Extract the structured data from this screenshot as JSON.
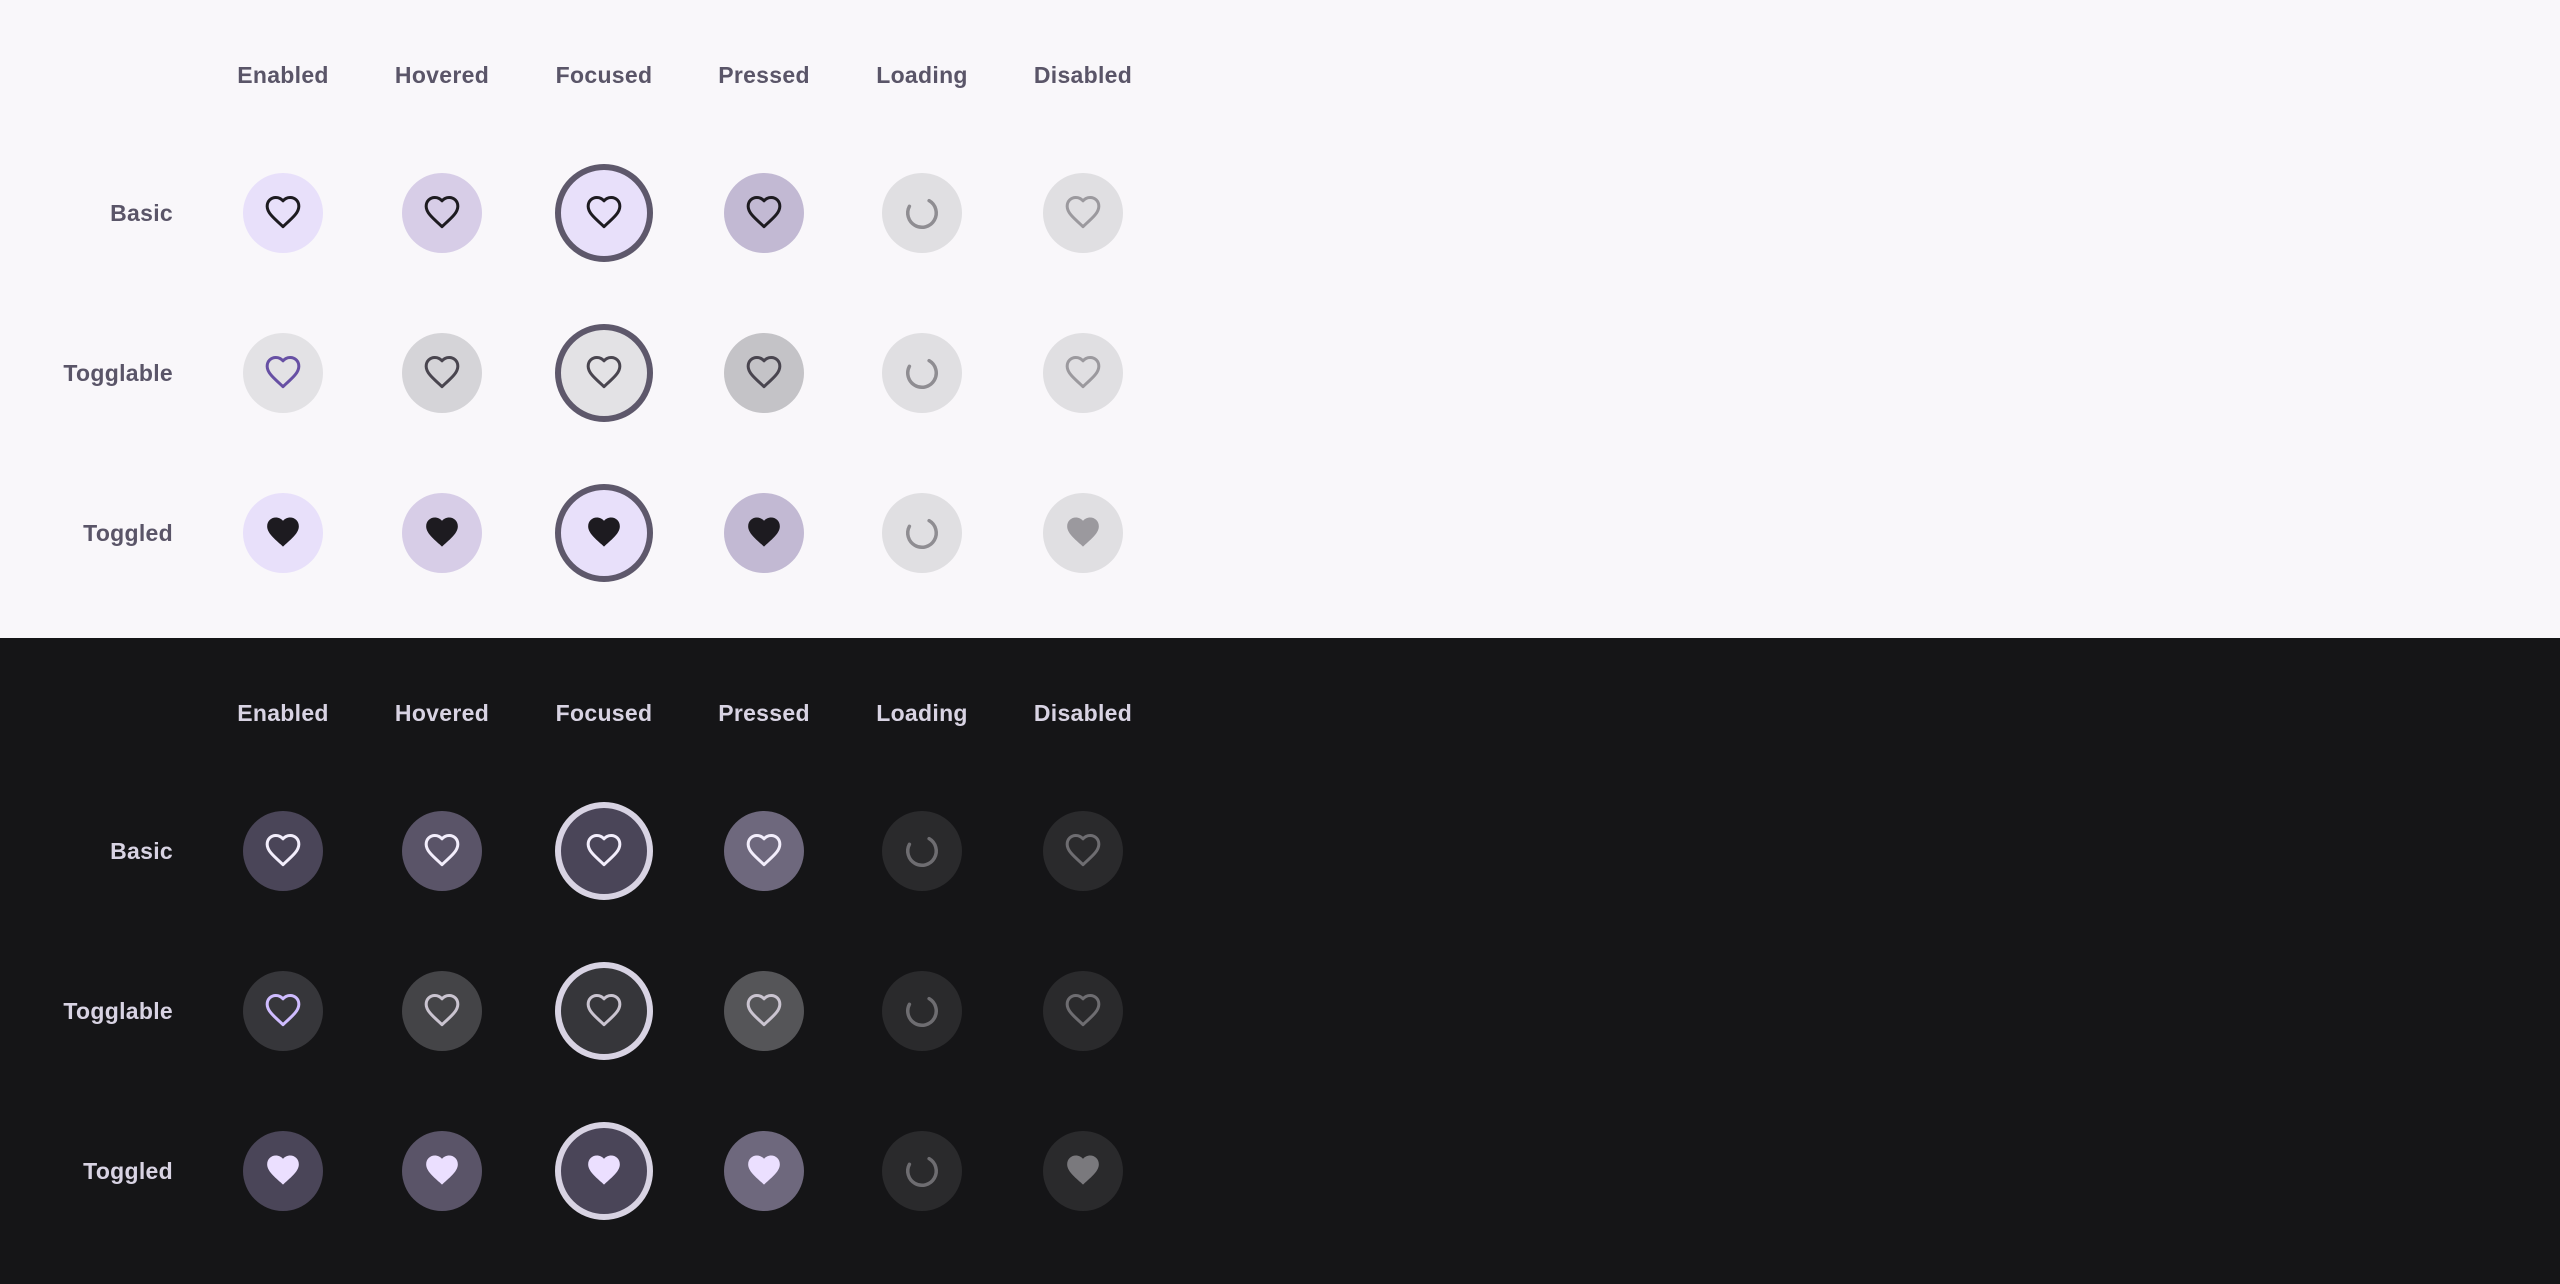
{
  "columns": [
    "Enabled",
    "Hovered",
    "Focused",
    "Pressed",
    "Loading",
    "Disabled"
  ],
  "rows": [
    "Basic",
    "Togglable",
    "Toggled"
  ],
  "states": [
    "enabled",
    "hovered",
    "focused",
    "pressed",
    "loading",
    "disabled"
  ],
  "icons": {
    "outline": "heart-outline-icon",
    "filled": "heart-filled-icon",
    "loading": "progress-spinner-icon"
  },
  "themes": {
    "light": {
      "name": "light",
      "background": "#f9f7fa",
      "text": "#5a5568",
      "focus_ring": "#5e586b",
      "rows": {
        "Basic": {
          "icon": "outline",
          "bg": [
            "#e8e0fa",
            "#d7cde7",
            "#e8e0fa",
            "#c2b9d3",
            "#e0dfe2",
            "#e0dfe2"
          ],
          "fg": [
            "#1d1b20",
            "#1d1b20",
            "#1d1b20",
            "#1d1b20",
            "#8f8d92",
            "#9b999e"
          ]
        },
        "Togglable": {
          "icon": "outline",
          "bg": [
            "#e3e2e5",
            "#d5d4d8",
            "#e3e2e5",
            "#c4c3c7",
            "#e0dfe2",
            "#e0dfe2"
          ],
          "fg": [
            "#6750a4",
            "#49454f",
            "#49454f",
            "#49454f",
            "#8f8d92",
            "#9b999e"
          ]
        },
        "Toggled": {
          "icon": "filled",
          "bg": [
            "#e8e0fa",
            "#d7cde7",
            "#e8e0fa",
            "#c2b9d3",
            "#e0dfe2",
            "#e0dfe2"
          ],
          "fg": [
            "#1d1b20",
            "#1d1b20",
            "#1d1b20",
            "#1d1b20",
            "#8f8d92",
            "#9b999e"
          ]
        }
      }
    },
    "dark": {
      "name": "dark",
      "background": "#151517",
      "text": "#d8d3e3",
      "focus_ring": "#d8d3e3",
      "rows": {
        "Basic": {
          "icon": "outline",
          "bg": [
            "#4a4558",
            "#5a5468",
            "#4a4558",
            "#6e687d",
            "#2a2a2c",
            "#2a2a2c"
          ],
          "fg": [
            "#f3eefc",
            "#f3eefc",
            "#f3eefc",
            "#f3eefc",
            "#6e6d71",
            "#6e6d71"
          ]
        },
        "Togglable": {
          "icon": "outline",
          "bg": [
            "#36363a",
            "#444447",
            "#36363a",
            "#555558",
            "#2a2a2c",
            "#2a2a2c"
          ],
          "fg": [
            "#cfbcff",
            "#cac4d0",
            "#cac4d0",
            "#cac4d0",
            "#6e6d71",
            "#6e6d71"
          ]
        },
        "Toggled": {
          "icon": "filled",
          "bg": [
            "#4a4558",
            "#5a5468",
            "#4a4558",
            "#6e687d",
            "#2a2a2c",
            "#2a2a2c"
          ],
          "fg": [
            "#ebdfff",
            "#ebdfff",
            "#ebdfff",
            "#ebdfff",
            "#6e6d71",
            "#7a797d"
          ]
        }
      }
    }
  }
}
